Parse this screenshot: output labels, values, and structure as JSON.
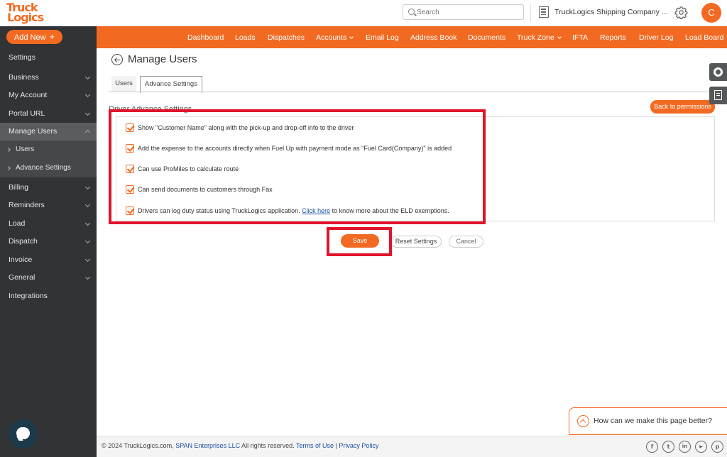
{
  "header": {
    "logo_line1": "Truck",
    "logo_line2": "Logics",
    "search_placeholder": "Search",
    "company_name": "TruckLogics Shipping Company ...",
    "avatar_initial": "C"
  },
  "sidebar": {
    "add_new_label": "Add New",
    "add_new_icon": "+",
    "items": [
      {
        "label": "Settings"
      },
      {
        "label": "Business"
      },
      {
        "label": "My Account"
      },
      {
        "label": "Portal URL"
      },
      {
        "label": "Manage Users"
      },
      {
        "label": "Users"
      },
      {
        "label": "Advance Settings"
      },
      {
        "label": "Billing"
      },
      {
        "label": "Reminders"
      },
      {
        "label": "Load"
      },
      {
        "label": "Dispatch"
      },
      {
        "label": "Invoice"
      },
      {
        "label": "General"
      },
      {
        "label": "Integrations"
      }
    ]
  },
  "nav": {
    "items": [
      {
        "label": "Dashboard"
      },
      {
        "label": "Loads"
      },
      {
        "label": "Dispatches"
      },
      {
        "label": "Accounts"
      },
      {
        "label": "Email Log"
      },
      {
        "label": "Address Book"
      },
      {
        "label": "Documents"
      },
      {
        "label": "Truck Zone"
      },
      {
        "label": "IFTA"
      },
      {
        "label": "Reports"
      },
      {
        "label": "Driver Log"
      },
      {
        "label": "Load Board"
      }
    ]
  },
  "main": {
    "title": "Manage Users",
    "tabs": [
      {
        "label": "Users"
      },
      {
        "label": "Advance Settings"
      }
    ],
    "section_title": "Driver Advance Settings",
    "back_to_permissions": "Back to permissions",
    "options": [
      {
        "text": "Show \"Customer Name\" along with the pick-up and drop-off info to the driver",
        "checked": true
      },
      {
        "text": "Add the expense to the accounts directly when Fuel Up with payment mode as \"Fuel Card(Company)\" is added",
        "checked": true
      },
      {
        "text": "Can use ProMiles to calculate route",
        "checked": true
      },
      {
        "text": "Can send documents to customers through Fax",
        "checked": true
      },
      {
        "text": "Drivers can log duty status using TruckLogics application.",
        "link": "Click here",
        "after": "to know more about the ELD exemptions.",
        "checked": true
      }
    ],
    "save_label": "Save",
    "reset_label": "Reset Settings",
    "cancel_label": "Cancel"
  },
  "feedback": {
    "label": "How can we make this page better?"
  },
  "footer": {
    "copyright": "© 2024 TruckLogics.com,",
    "company_link": "SPAN Enterprises LLC",
    "rights": "All rights reserved.",
    "terms": "Terms of Use",
    "separator": "|",
    "privacy": "Privacy Policy",
    "social": [
      {
        "icon": "facebook-icon",
        "glyph": "f"
      },
      {
        "icon": "twitter-icon",
        "glyph": "t"
      },
      {
        "icon": "linkedin-icon",
        "glyph": "in"
      },
      {
        "icon": "youtube-icon",
        "glyph": "▶"
      },
      {
        "icon": "pinterest-icon",
        "glyph": "p"
      }
    ]
  },
  "colors": {
    "brand_orange": "#f26a21",
    "sidebar_bg": "#313335",
    "highlight_red": "#e0142b",
    "link_blue": "#1a4fa3"
  }
}
